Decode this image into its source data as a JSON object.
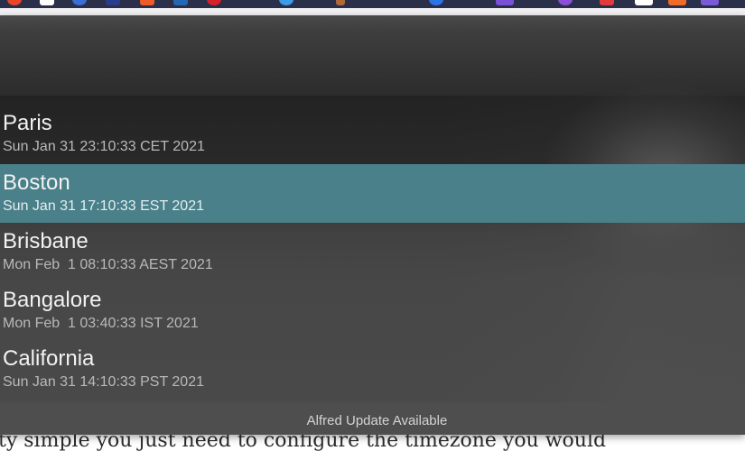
{
  "menubar": {
    "icon_colors": [
      "#e8452c",
      "#ffffff",
      "#3b6fd6",
      "#2b3a8a",
      "#f05a28",
      "#2667b3",
      "#d6202a",
      "#3b9be8",
      "#b06a3a",
      "#2b74e8",
      "#7b4fd6",
      "#8a4fd6",
      "#e23b3b",
      "#ffffff",
      "#f06a2a",
      "#7a5ad6"
    ]
  },
  "background_page": {
    "text": "ty simple you just need to configure the timezone you would"
  },
  "alfred": {
    "results": [
      {
        "title": "Paris",
        "subtitle": "Sun Jan 31 23:10:33 CET 2021",
        "selected": false
      },
      {
        "title": "Boston",
        "subtitle": "Sun Jan 31 17:10:33 EST 2021",
        "selected": true
      },
      {
        "title": "Brisbane",
        "subtitle": "Mon Feb  1 08:10:33 AEST 2021",
        "selected": false
      },
      {
        "title": "Bangalore",
        "subtitle": "Mon Feb  1 03:40:33 IST 2021",
        "selected": false
      },
      {
        "title": "California",
        "subtitle": "Sun Jan 31 14:10:33 PST 2021",
        "selected": false
      }
    ],
    "footer": "Alfred Update Available",
    "selected_color": "#4a8089"
  }
}
